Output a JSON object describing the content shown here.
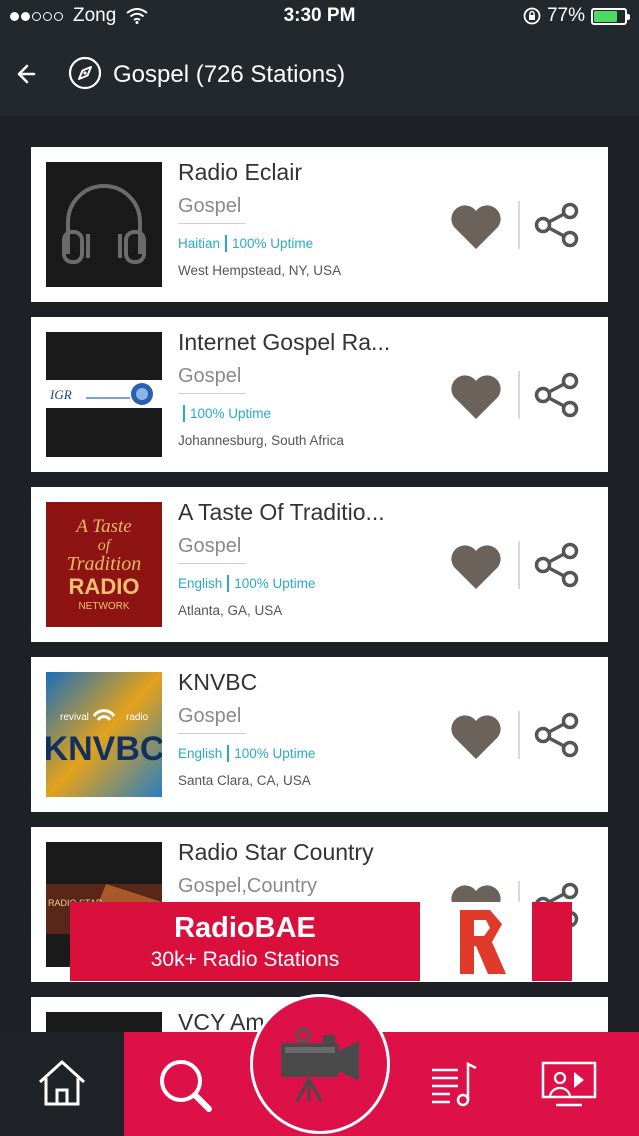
{
  "status_bar": {
    "carrier": "Zong",
    "time": "3:30 PM",
    "battery": "77%",
    "battery_level": 0.77,
    "signal_bars_filled": 2,
    "signal_bars_total": 5
  },
  "header": {
    "back_icon": "back-arrow-icon",
    "genre_icon": "compass-icon",
    "title": "Gospel (726 Stations)"
  },
  "stations": [
    {
      "name": "Radio Eclair",
      "genre": "Gospel",
      "language": "Haitian",
      "uptime": "100% Uptime",
      "location": "West Hempstead, NY, USA"
    },
    {
      "name": "Internet Gospel Ra...",
      "genre": "Gospel",
      "language": "",
      "uptime": "100% Uptime",
      "location": "Johannesburg, South Africa"
    },
    {
      "name": "A Taste Of Traditio...",
      "genre": "Gospel",
      "language": "English",
      "uptime": "100% Uptime",
      "location": "Atlanta, GA, USA"
    },
    {
      "name": "KNVBC",
      "genre": "Gospel",
      "language": "English",
      "uptime": "100% Uptime",
      "location": "Santa Clara, CA, USA"
    },
    {
      "name": "Radio Star Country",
      "genre": "Gospel,Country",
      "language": "",
      "uptime": "",
      "location": ""
    },
    {
      "name": "VCY Am",
      "genre": "",
      "language": "",
      "uptime": "",
      "location": ""
    }
  ],
  "logos": {
    "igr": "IGR",
    "taste_line1": "A Taste",
    "taste_line2": "of",
    "taste_line3": "Tradition",
    "taste_line4": "RADIO",
    "taste_line5": "NETWORK",
    "knvbc_top_left": "revival",
    "knvbc_top_right": "radio",
    "knvbc_main": "KNVBC",
    "radiostar": "RADIO STAR"
  },
  "ad": {
    "title": "RadioBAE",
    "subtitle": "30k+ Radio Stations"
  },
  "bottom_nav": {
    "items": [
      "home-icon",
      "search-icon",
      "record-camera-icon",
      "playlist-icon",
      "video-icon"
    ]
  },
  "colors": {
    "accent": "#dd1148",
    "uptime_blue": "#2aaac9",
    "header_bg": "#23282d"
  }
}
